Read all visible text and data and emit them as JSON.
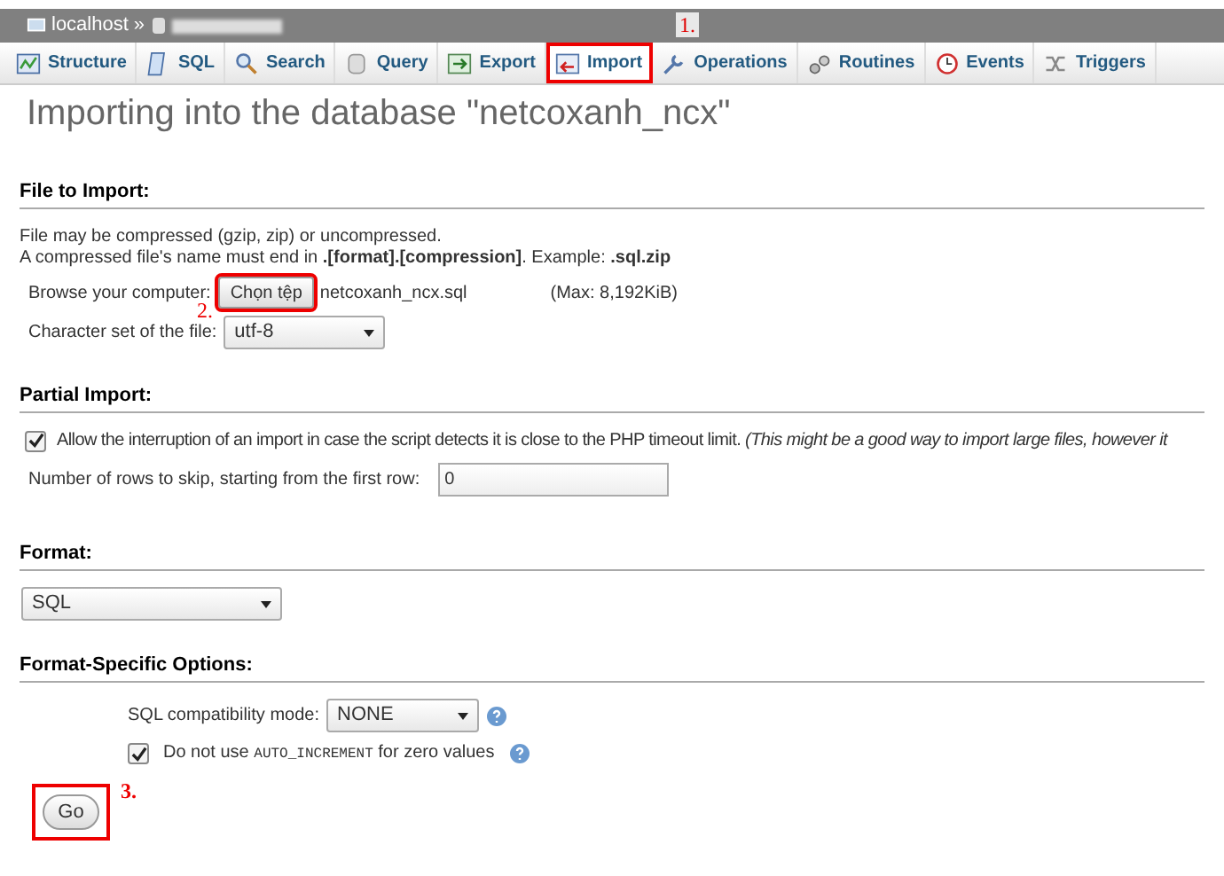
{
  "breadcrumb": {
    "server": "localhost",
    "separator": "»"
  },
  "tabs": [
    {
      "label": "Structure",
      "selected": false,
      "highlighted": false
    },
    {
      "label": "SQL",
      "selected": false,
      "highlighted": false
    },
    {
      "label": "Search",
      "selected": false,
      "highlighted": false
    },
    {
      "label": "Query",
      "selected": false,
      "highlighted": false
    },
    {
      "label": "Export",
      "selected": false,
      "highlighted": false
    },
    {
      "label": "Import",
      "selected": true,
      "highlighted": true
    },
    {
      "label": "Operations",
      "selected": false,
      "highlighted": false
    },
    {
      "label": "Routines",
      "selected": false,
      "highlighted": false
    },
    {
      "label": "Events",
      "selected": false,
      "highlighted": false
    },
    {
      "label": "Triggers",
      "selected": false,
      "highlighted": false
    }
  ],
  "annotations": [
    "1.",
    "2.",
    "3."
  ],
  "title": "Importing into the database \"netcoxanh_ncx\"",
  "file_section": {
    "heading": "File to Import:",
    "note_1": "File may be compressed (gzip, zip) or uncompressed.",
    "note_2": "A compressed file's name must end in **.[format].[compression]**. Example: **.sql.zip**",
    "browse_label": "Browse your computer:",
    "browse_button": "Chọn tệp",
    "browse_highlighted": true,
    "file_name": "netcoxanh_ncx.sql",
    "max": "(Max: 8,192KiB)",
    "charset_label": "Character set of the file:",
    "charset_value": "utf-8"
  },
  "partial_section": {
    "heading": "Partial Import:",
    "allow_checked": true,
    "allow_label": "Allow the interruption of an import in case the script detects it is close to the PHP timeout limit.",
    "allow_note": "(This might be a good way to import large files, however it",
    "skip_label": "Number of rows to skip, starting from the first row:",
    "skip_value": "0"
  },
  "format_section": {
    "heading": "Format:",
    "value": "SQL"
  },
  "options_section": {
    "heading": "Format-Specific Options:",
    "compat_label": "SQL compatibility mode:",
    "compat_value": "NONE",
    "auto_checked": true,
    "auto_label_1": "Do not use",
    "auto_label_code": "AUTO_INCREMENT",
    "auto_label_2": "for zero values"
  },
  "go": {
    "label": "Go",
    "highlighted": true
  }
}
